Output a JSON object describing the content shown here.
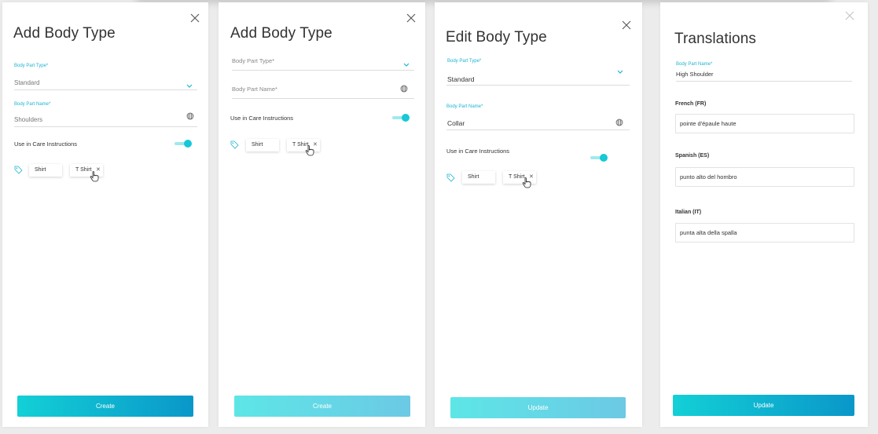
{
  "panels": [
    {
      "title": "Add Body Type",
      "body_part_type": {
        "label": "Body Part Type*",
        "value": "Standard"
      },
      "body_part_name": {
        "label": "Body Part Name*",
        "value": "Shoulders"
      },
      "care_instructions_label": "Use in Care Instructions",
      "care_instructions_on": true,
      "tags": [
        "Shirt",
        "T Shirt"
      ],
      "button_label": "Create"
    },
    {
      "title": "Add Body Type",
      "body_part_type": {
        "placeholder": "Body Part Type*"
      },
      "body_part_name": {
        "placeholder": "Body Part Name*"
      },
      "care_instructions_label": "Use in Care Instructions",
      "care_instructions_on": true,
      "tags": [
        "Shirt",
        "T Shirt"
      ],
      "button_label": "Create"
    },
    {
      "title": "Edit Body Type",
      "body_part_type": {
        "label": "Body Part Type*",
        "value": "Standard"
      },
      "body_part_name": {
        "label": "Body Part Name*",
        "value": "Collar"
      },
      "care_instructions_label": "Use in Care Instructions",
      "care_instructions_on": true,
      "tags": [
        "Shirt",
        "T Shirt"
      ],
      "button_label": "Update"
    },
    {
      "title": "Translations",
      "body_part_name": {
        "label": "Body Part Name*",
        "value": "High Shoulder"
      },
      "translations": [
        {
          "language": "French (FR)",
          "value": "pointe d'épaule haute"
        },
        {
          "language": "Spanish (ES)",
          "value": "punto alto del hombro"
        },
        {
          "language": "Italian (IT)",
          "value": "punta alta della spalla"
        }
      ],
      "button_label": "Update"
    }
  ],
  "icons": {
    "close": "close-icon",
    "chevron": "chevron-down-icon",
    "globe": "globe-icon",
    "tag": "tag-icon",
    "cursor": "hand-cursor-icon"
  },
  "colors": {
    "accent": "#1bb5d3",
    "toggle_knob": "#17c8d6",
    "button_start": "#13d0d6",
    "button_end": "#0a97c9"
  }
}
